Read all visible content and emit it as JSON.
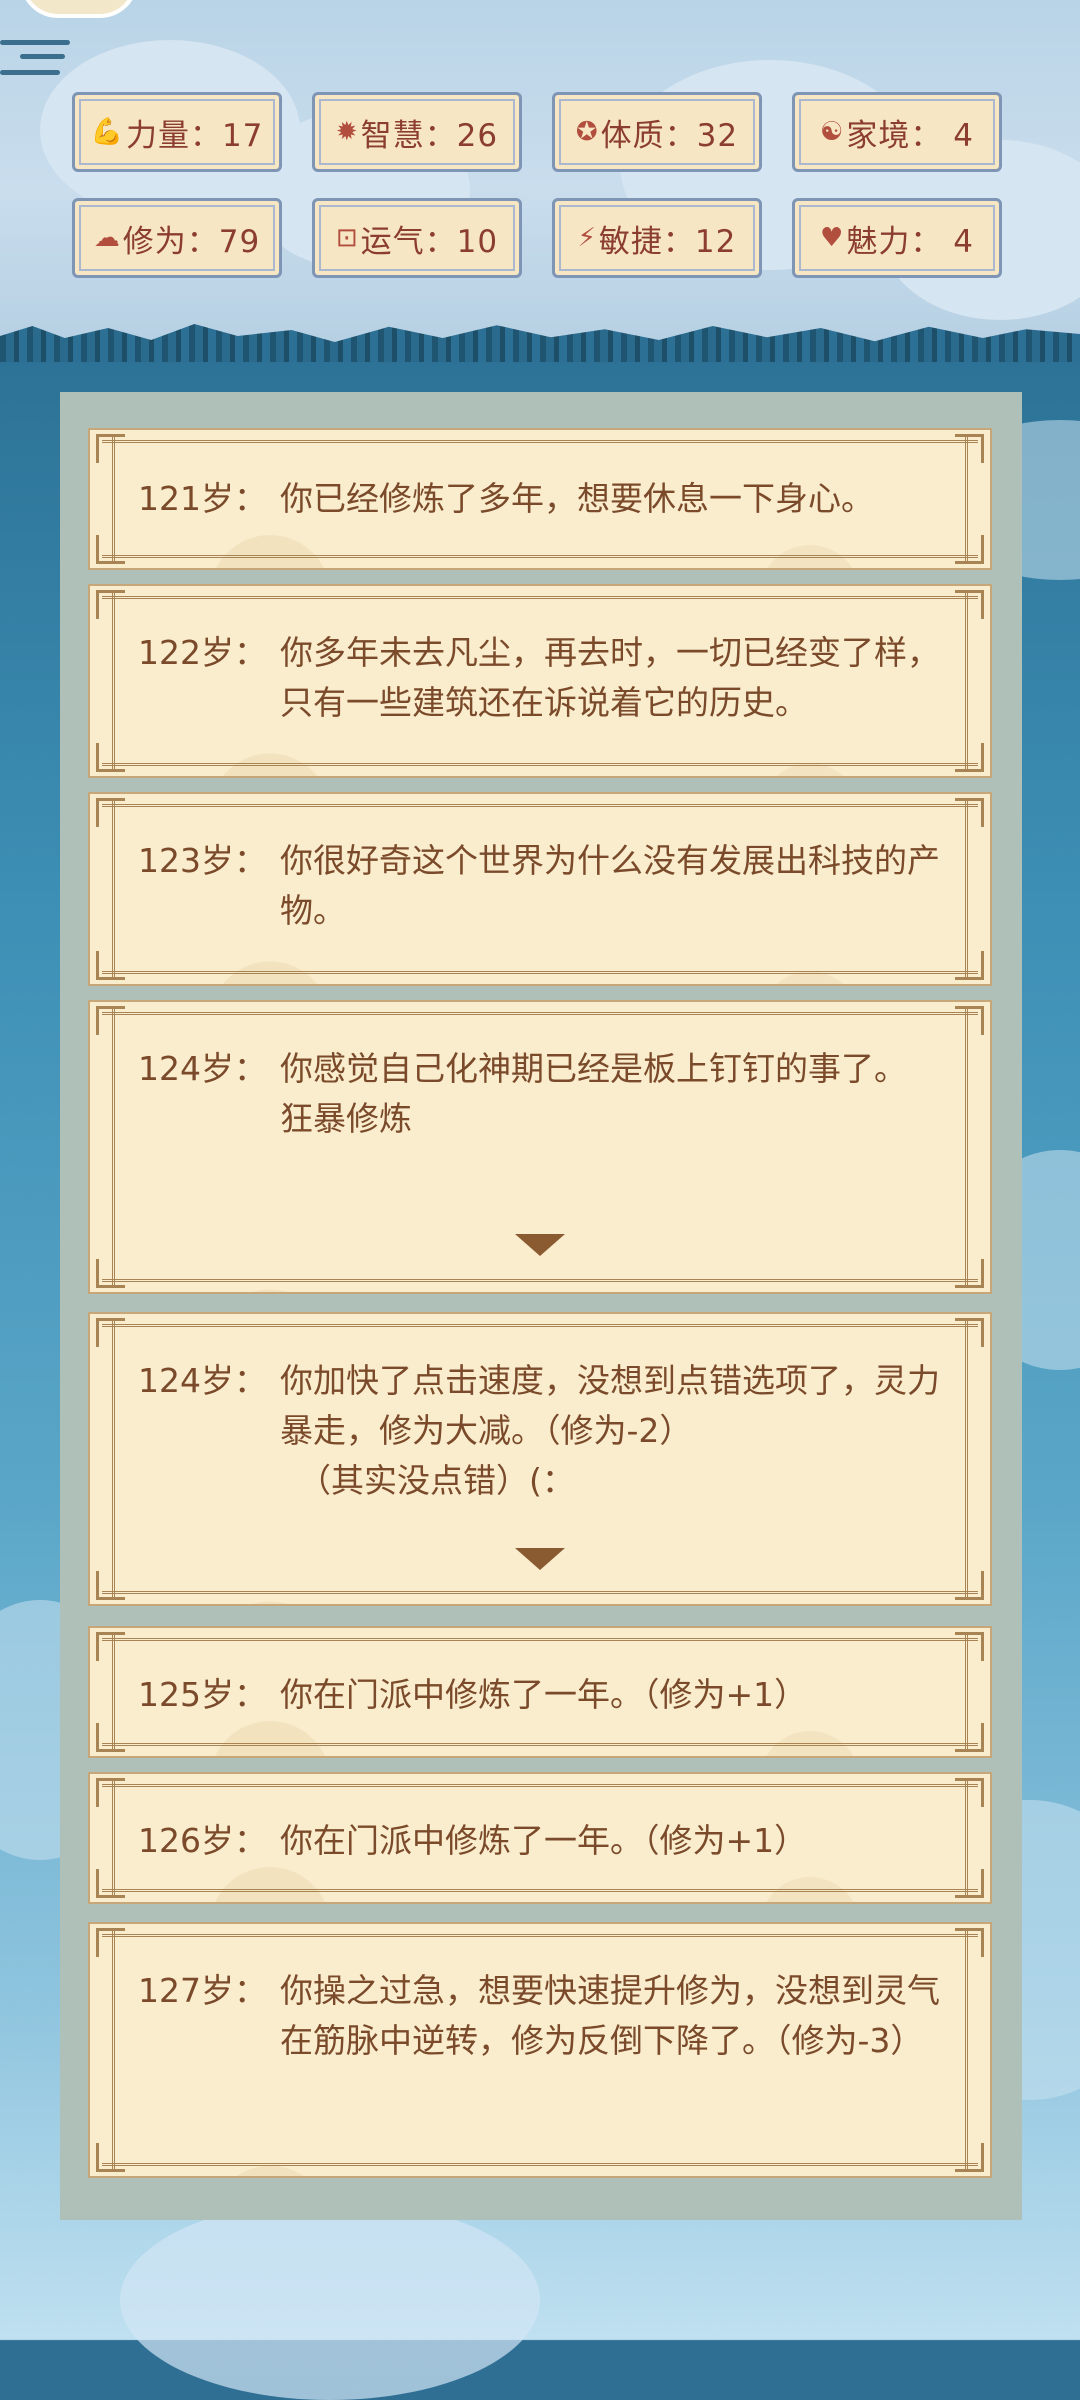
{
  "stats": [
    {
      "icon": "strength-icon",
      "glyph": "💪",
      "label": "力量：17"
    },
    {
      "icon": "wisdom-icon",
      "glyph": "✹",
      "label": "智慧：26"
    },
    {
      "icon": "constitution-icon",
      "glyph": "✪",
      "label": "体质：32"
    },
    {
      "icon": "family-icon",
      "glyph": "☯",
      "label": "家境： 4"
    },
    {
      "icon": "cultivation-icon",
      "glyph": "☁",
      "label": "修为：79"
    },
    {
      "icon": "luck-icon",
      "glyph": "⊡",
      "label": "运气：10"
    },
    {
      "icon": "agility-icon",
      "glyph": "⚡",
      "label": "敏捷：12"
    },
    {
      "icon": "charm-icon",
      "glyph": "♥",
      "label": "魅力： 4"
    }
  ],
  "events": [
    {
      "age": "121岁：",
      "text": "你已经修炼了多年，想要休息一下身心。",
      "extra": "",
      "extra2": ""
    },
    {
      "age": "122岁：",
      "text": "你多年未去凡尘，再去时，一切已经变了样，只有一些建筑还在诉说着它的历史。",
      "extra": "",
      "extra2": ""
    },
    {
      "age": "123岁：",
      "text": "你很好奇这个世界为什么没有发展出科技的产物。",
      "extra": "",
      "extra2": ""
    },
    {
      "age": "124岁：",
      "text": "你感觉自己化神期已经是板上钉钉的事了。",
      "extra": "狂暴修炼",
      "extra2": ""
    },
    {
      "age": "124岁：",
      "text": "你加快了点击速度，没想到点错选项了，灵力暴走，修为大减。（修为-2）",
      "extra": "",
      "extra2": "（其实没点错）(："
    },
    {
      "age": "125岁：",
      "text": "你在门派中修炼了一年。（修为+1）",
      "extra": "",
      "extra2": ""
    },
    {
      "age": "126岁：",
      "text": "你在门派中修炼了一年。（修为+1）",
      "extra": "",
      "extra2": ""
    },
    {
      "age": "127岁：",
      "text": "你操之过急，想要快速提升修为，没想到灵气在筋脉中逆转，修为反倒下降了。（修为-3）",
      "extra": "",
      "extra2": ""
    }
  ]
}
